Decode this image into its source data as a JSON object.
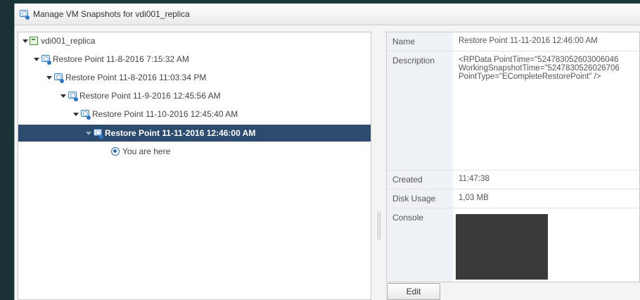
{
  "window": {
    "title": "Manage VM Snapshots for vdi001_replica",
    "icon": "vm-snapshot-icon"
  },
  "tree": {
    "root_label": "vdi001_replica",
    "items": [
      {
        "label": "Restore Point 11-8-2016 7:15:32 AM"
      },
      {
        "label": "Restore Point 11-8-2016 11:03:34 PM"
      },
      {
        "label": "Restore Point 11-9-2016 12:45:56 AM"
      },
      {
        "label": "Restore Point 11-10-2016 12:45:40 AM"
      },
      {
        "label": "Restore Point 11-11-2016 12:46:00 AM",
        "selected": true
      }
    ],
    "you_are_here": "You are here"
  },
  "details": {
    "name_label": "Name",
    "name_value": "Restore Point 11-11-2016 12:46:00 AM",
    "description_label": "Description",
    "description_lines": [
      "<RPData PointTime=\"524783052603006046",
      "WorkingSnapshotTime=\"5247830526026706",
      "PointType=\"ECompleteRestorePoint\" />"
    ],
    "created_label": "Created",
    "created_value": "11:47:38",
    "disk_usage_label": "Disk Usage",
    "disk_usage_value": "1,03 MB",
    "console_label": "Console"
  },
  "buttons": {
    "edit_label": "Edit"
  },
  "colors": {
    "selection": "#2c4b6f",
    "label_bg": "#eef2f6",
    "desktop": "#1c3a3c"
  }
}
